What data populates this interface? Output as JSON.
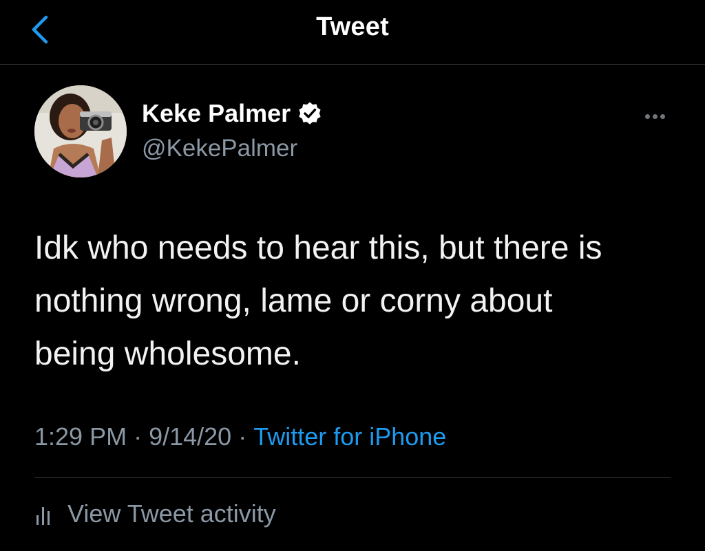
{
  "navbar": {
    "title": "Tweet",
    "back_icon": "chevron-left-icon",
    "accent_color": "#1d9bf0"
  },
  "author": {
    "display_name": "Keke Palmer",
    "handle": "@KekePalmer",
    "verified": true,
    "verified_icon": "verified-badge-icon",
    "more_icon": "more-horizontal-icon"
  },
  "tweet": {
    "lines": [
      "Idk who needs to hear this, but there is",
      "nothing wrong, lame or corny about",
      "being wholesome."
    ]
  },
  "meta": {
    "time": "1:29 PM",
    "separator": "·",
    "date": "9/14/20",
    "source": "Twitter for iPhone"
  },
  "activity": {
    "icon": "analytics-bars-icon",
    "label": "View Tweet activity"
  },
  "colors": {
    "background": "#000000",
    "text_primary": "#ffffff",
    "text_secondary": "#8b98a5",
    "link": "#1d9bf0",
    "divider": "#2f3336"
  }
}
